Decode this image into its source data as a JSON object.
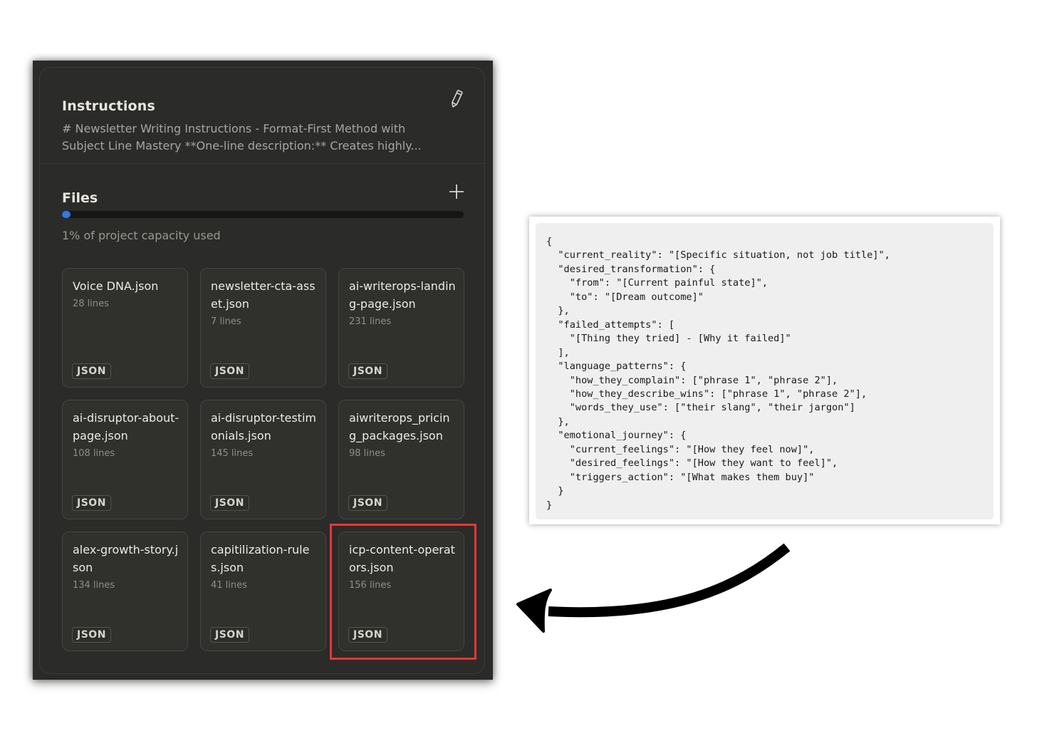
{
  "instructions": {
    "title": "Instructions",
    "description": "# Newsletter Writing Instructions - Format-First Method with Subject Line Mastery **One-line description:** Creates highly...",
    "edit_icon": "pencil-icon"
  },
  "files": {
    "title": "Files",
    "add_icon": "plus-icon",
    "capacity_fraction": 0.01,
    "capacity_text": "1% of project capacity used",
    "items": [
      {
        "name": "Voice DNA.json",
        "lines": "28 lines",
        "type": "JSON"
      },
      {
        "name": "newsletter-cta-asset.json",
        "lines": "7 lines",
        "type": "JSON"
      },
      {
        "name": "ai-writerops-landing-page.json",
        "lines": "231 lines",
        "type": "JSON"
      },
      {
        "name": "ai-disruptor-about-page.json",
        "lines": "108 lines",
        "type": "JSON"
      },
      {
        "name": "ai-disruptor-testimonials.json",
        "lines": "145 lines",
        "type": "JSON"
      },
      {
        "name": "aiwriterops_pricing_packages.json",
        "lines": "98 lines",
        "type": "JSON"
      },
      {
        "name": "alex-growth-story.json",
        "lines": "134 lines",
        "type": "JSON"
      },
      {
        "name": "capitilization-rules.json",
        "lines": "41 lines",
        "type": "JSON"
      },
      {
        "name": "icp-content-operators.json",
        "lines": "156 lines",
        "type": "JSON"
      }
    ],
    "highlighted_item": "icp-content-operators.json"
  },
  "code_card": {
    "content": "{\n  \"current_reality\": \"[Specific situation, not job title]\",\n  \"desired_transformation\": {\n    \"from\": \"[Current painful state]\",\n    \"to\": \"[Dream outcome]\"\n  },\n  \"failed_attempts\": [\n    \"[Thing they tried] - [Why it failed]\"\n  ],\n  \"language_patterns\": {\n    \"how_they_complain\": [\"phrase 1\", \"phrase 2\"],\n    \"how_they_describe_wins\": [\"phrase 1\", \"phrase 2\"],\n    \"words_they_use\": [\"their slang\", \"their jargon\"]\n  },\n  \"emotional_journey\": {\n    \"current_feelings\": \"[How they feel now]\",\n    \"desired_feelings\": \"[How they want to feel]\",\n    \"triggers_action\": \"[What makes them buy]\"\n  }\n}"
  },
  "colors": {
    "panel_bg": "#2b2b29",
    "accent": "#2f7be0",
    "highlight": "#e53935",
    "arrow": "#000000"
  }
}
